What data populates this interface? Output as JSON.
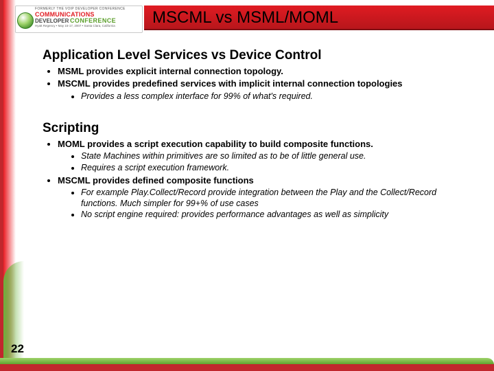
{
  "header": {
    "title": "MSCML vs MSML/MOML",
    "logo": {
      "former": "FORMERLY THE VOIP DEVELOPER CONFERENCE",
      "line1": "COMMUNICATIONS",
      "line2": "DEVELOPER",
      "line3": "CONFERENCE",
      "sub": "Hyatt Regency • May 15-17, 2007 • Santa Clara, California"
    }
  },
  "page_number": "22",
  "sections": [
    {
      "heading": "Application Level Services vs Device Control",
      "bullets": [
        {
          "text": "MSML provides explicit internal connection topology.",
          "sub": []
        },
        {
          "text": "MSCML provides predefined services with implicit internal connection topologies",
          "sub": [
            "Provides a less complex interface for 99% of what's required."
          ]
        }
      ]
    },
    {
      "heading": "Scripting",
      "bullets": [
        {
          "text": "MOML provides a script execution capability to build composite functions.",
          "sub": [
            "State Machines within primitives are so limited as to be of little general use.",
            "Requires a script execution framework."
          ]
        },
        {
          "text": "MSCML provides defined composite functions",
          "sub": [
            "For example Play.Collect/Record provide integration between the Play and the Collect/Record functions.  Much simpler for 99+% of use cases",
            "No script engine required: provides performance advantages as well as simplicity"
          ]
        }
      ]
    }
  ]
}
